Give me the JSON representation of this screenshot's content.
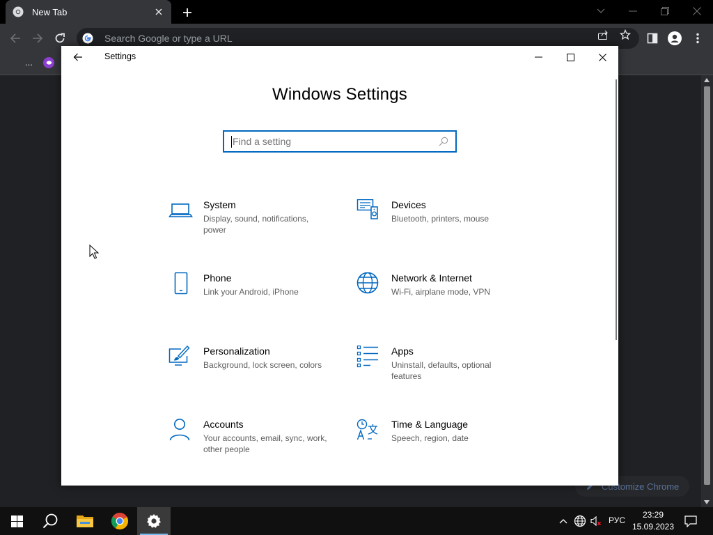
{
  "chrome": {
    "tab_title": "New Tab",
    "omnibox_placeholder": "Search Google or type a URL",
    "bookmarks_more": "...",
    "customize_label": "Customize Chrome"
  },
  "settings": {
    "window_title": "Settings",
    "heading": "Windows Settings",
    "search_placeholder": "Find a setting",
    "categories": [
      {
        "name": "System",
        "desc": "Display, sound, notifications, power",
        "icon": "laptop-icon"
      },
      {
        "name": "Devices",
        "desc": "Bluetooth, printers, mouse",
        "icon": "devices-icon"
      },
      {
        "name": "Phone",
        "desc": "Link your Android, iPhone",
        "icon": "phone-icon"
      },
      {
        "name": "Network & Internet",
        "desc": "Wi-Fi, airplane mode, VPN",
        "icon": "globe-icon"
      },
      {
        "name": "Personalization",
        "desc": "Background, lock screen, colors",
        "icon": "paint-icon"
      },
      {
        "name": "Apps",
        "desc": "Uninstall, defaults, optional features",
        "icon": "apps-list-icon"
      },
      {
        "name": "Accounts",
        "desc": "Your accounts, email, sync, work, other people",
        "icon": "person-icon"
      },
      {
        "name": "Time & Language",
        "desc": "Speech, region, date",
        "icon": "time-language-icon"
      }
    ]
  },
  "taskbar": {
    "language": "РУС",
    "time": "23:29",
    "date": "15.09.2023"
  },
  "colors": {
    "accent": "#0067c0",
    "chrome_bg": "#202124",
    "chrome_toolbar": "#35363a",
    "taskbar": "#101010"
  }
}
